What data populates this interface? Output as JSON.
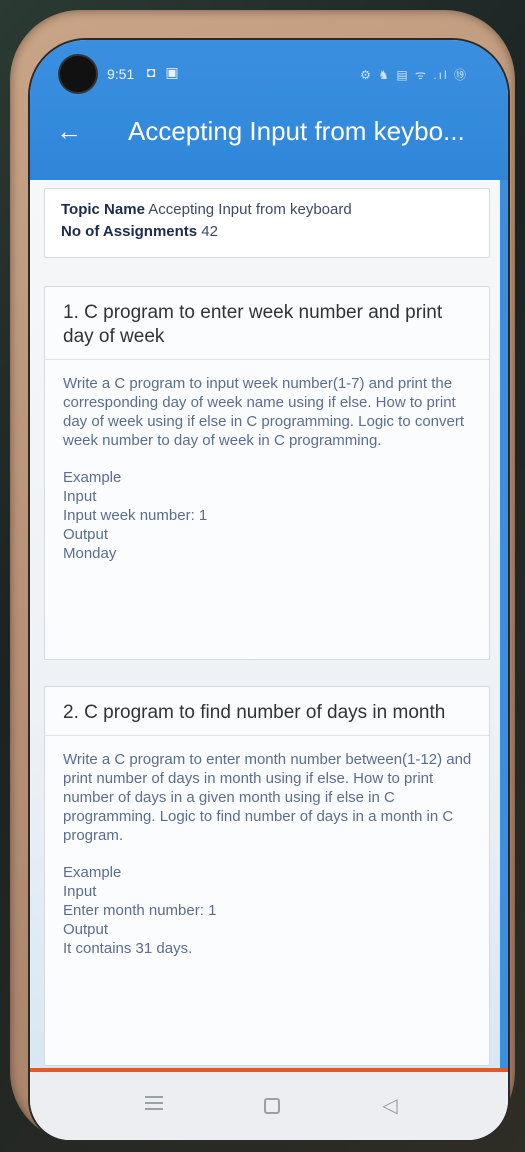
{
  "status_bar": {
    "time": "9:51",
    "left_icons": "◘ ▣",
    "right_icons": "⚙ ♞ ▤ ᯤ .ıl ⑲"
  },
  "app_bar": {
    "back_icon": "back-arrow-icon",
    "title": "Accepting Input from keybo..."
  },
  "topic": {
    "name_label": "Topic Name",
    "name_value": "Accepting Input from keyboard",
    "count_label": "No of Assignments",
    "count_value": "42"
  },
  "assignments": [
    {
      "title": "1. C program to enter week number and print day of week",
      "description": "Write a C program to input week number(1-7) and print the corresponding day of week name using if else. How to print day of week using if else in C programming. Logic to convert week number to day of week in C programming.",
      "example": [
        "Example",
        "Input",
        "Input week number: 1",
        "Output",
        "Monday"
      ]
    },
    {
      "title": "2. C program to find number of days in month",
      "description": "Write a C program to enter month number between(1-12) and print number of days in month using if else. How to print number of days in a given month using if else in C programming. Logic to find number of days in a month in C program.",
      "example": [
        "Example",
        "Input",
        "Enter month number: 1",
        "Output",
        "It contains 31 days."
      ]
    }
  ],
  "colors": {
    "app_bar": "#2f86d8",
    "accent_line": "#e05a2b"
  },
  "nav": {
    "menu_icon": "recent-apps-icon",
    "home_icon": "home-icon",
    "back_icon": "back-triangle-icon"
  }
}
